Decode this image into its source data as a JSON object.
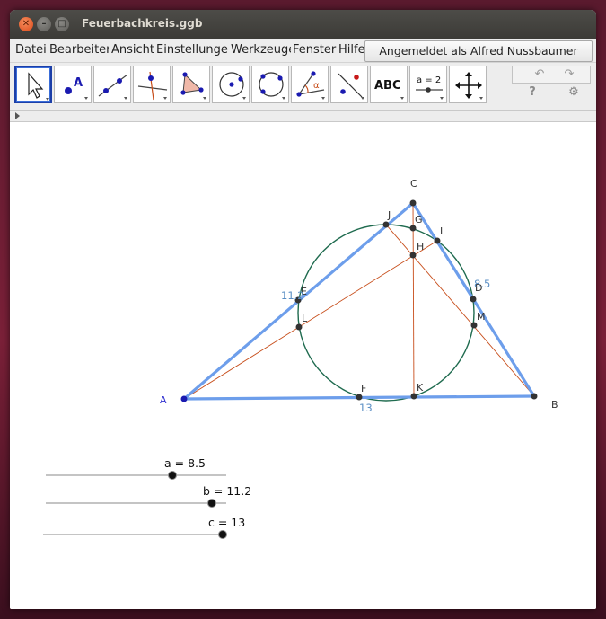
{
  "window": {
    "title": "Feuerbachkreis.ggb"
  },
  "titlebar_buttons": [
    "close",
    "minimize",
    "maximize"
  ],
  "menu": {
    "items": [
      "Datei",
      "Bearbeiten",
      "Ansicht",
      "Einstellungen",
      "Werkzeuge",
      "Fenster",
      "Hilfe"
    ],
    "login": "Angemeldet als Alfred Nussbaumer"
  },
  "toolbar": {
    "tools": [
      {
        "name": "move-tool",
        "icon": "cursor-arrow-icon"
      },
      {
        "name": "point-tool",
        "icon": "point-icon",
        "text": "A"
      },
      {
        "name": "line-tool",
        "icon": "line-through-points-icon"
      },
      {
        "name": "perpendicular-tool",
        "icon": "perpendicular-line-icon"
      },
      {
        "name": "polygon-tool",
        "icon": "polygon-icon"
      },
      {
        "name": "circle-tool",
        "icon": "circle-center-point-icon"
      },
      {
        "name": "conic-tool",
        "icon": "circle-three-points-icon"
      },
      {
        "name": "angle-tool",
        "icon": "angle-icon",
        "text": "α"
      },
      {
        "name": "reflect-tool",
        "icon": "reflect-about-line-icon"
      },
      {
        "name": "text-tool",
        "icon": "text-icon",
        "text": "ABC"
      },
      {
        "name": "slider-tool",
        "icon": "slider-icon",
        "text": "a = 2"
      },
      {
        "name": "move-view-tool",
        "icon": "move-graphics-view-icon"
      }
    ],
    "undo": "↶",
    "redo": "↷",
    "help": "?",
    "settings": "⚙"
  },
  "construction": {
    "points": [
      "A",
      "B",
      "C",
      "D",
      "E",
      "F",
      "G",
      "H",
      "I",
      "J",
      "K",
      "L",
      "M"
    ],
    "side_labels": [
      "11.2",
      "8.5",
      "13"
    ]
  },
  "sliders": [
    {
      "name": "a",
      "label": "a = 8.5",
      "value": 8.5
    },
    {
      "name": "b",
      "label": "b = 11.2",
      "value": 11.2
    },
    {
      "name": "c",
      "label": "c = 13",
      "value": 13
    }
  ],
  "colors": {
    "triangle": "#6d9eeb",
    "circle": "#1f6b4f",
    "cevians": "#c74d1a",
    "point": "#333333",
    "point_A": "#1a1ab0",
    "label_A": "#3030d0"
  }
}
